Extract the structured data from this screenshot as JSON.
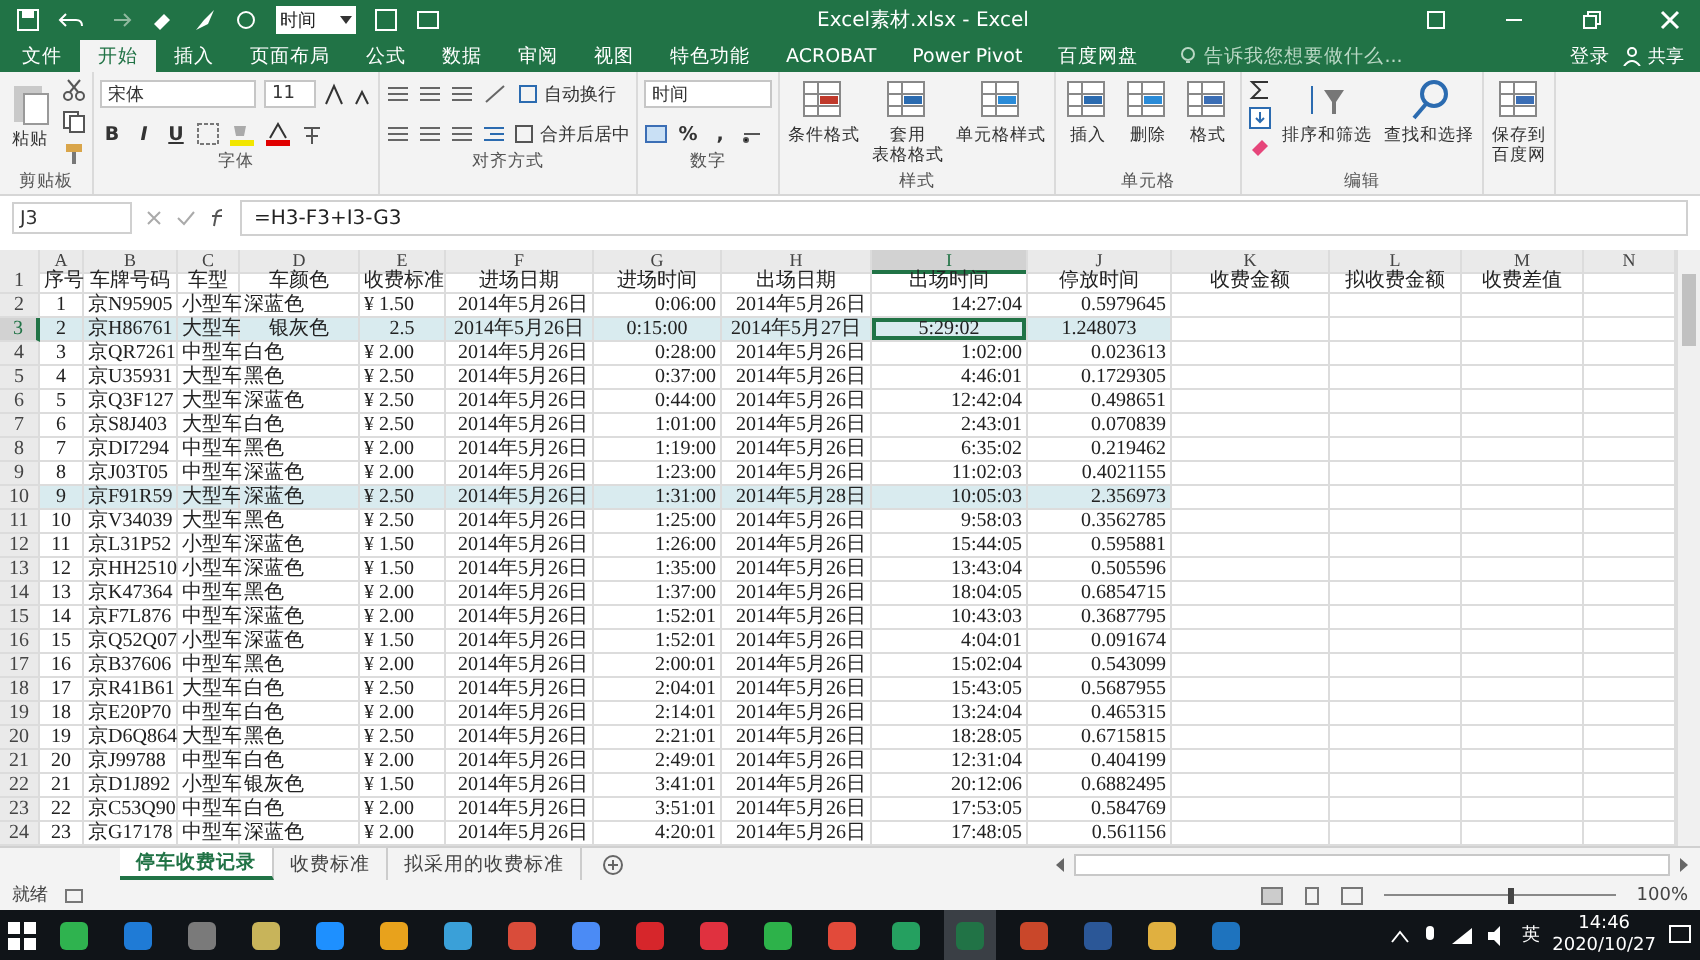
{
  "quick_access": {
    "combo": "时间"
  },
  "window": {
    "title": "Excel素材.xlsx - Excel"
  },
  "ribbon_tabs": [
    {
      "label": "文件",
      "selected": false
    },
    {
      "label": "开始",
      "selected": true
    },
    {
      "label": "插入",
      "selected": false
    },
    {
      "label": "页面布局",
      "selected": false
    },
    {
      "label": "公式",
      "selected": false
    },
    {
      "label": "数据",
      "selected": false
    },
    {
      "label": "审阅",
      "selected": false
    },
    {
      "label": "视图",
      "selected": false
    },
    {
      "label": "特色功能",
      "selected": false
    },
    {
      "label": "ACROBAT",
      "selected": false
    },
    {
      "label": "Power Pivot",
      "selected": false
    },
    {
      "label": "百度网盘",
      "selected": false
    }
  ],
  "search": {
    "placeholder": "告诉我您想要做什么..."
  },
  "account": {
    "sign_in": "登录",
    "share": "共享"
  },
  "ribbon_groups": [
    {
      "kind": "clipboard",
      "label": "剪贴板",
      "buttons": [
        "粘贴"
      ]
    },
    {
      "kind": "font",
      "label": "字体",
      "font": "宋体",
      "size": "11",
      "buttons": [
        "B",
        "I",
        "U"
      ]
    },
    {
      "kind": "alignment",
      "label": "对齐方式",
      "buttons": [
        "自动换行",
        "合并后居中"
      ]
    },
    {
      "kind": "number",
      "label": "数字",
      "format": "时间",
      "buttons": [
        "%",
        ","
      ]
    },
    {
      "kind": "large",
      "label": "样式",
      "buttons": [
        "条件格式",
        [
          "套用",
          "表格格式"
        ],
        "单元格样式"
      ]
    },
    {
      "kind": "large",
      "label": "单元格",
      "buttons": [
        "插入",
        "删除",
        "格式"
      ]
    },
    {
      "kind": "editing",
      "label": "编辑",
      "buttons": [
        "排序和筛选",
        "查找和选择"
      ]
    },
    {
      "kind": "large",
      "buttons": [
        [
          "保存到",
          "百度网"
        ]
      ]
    }
  ],
  "formula_bar": {
    "name_box": "J3",
    "formula": "=H3-F3+I3-G3"
  },
  "sheet": {
    "header_row": {
      "number": "1",
      "selected": false
    },
    "columns": [
      {
        "letter": "A",
        "header": "序号",
        "selected": false
      },
      {
        "letter": "B",
        "header": "车牌号码",
        "selected": false
      },
      {
        "letter": "C",
        "header": "车型",
        "selected": false
      },
      {
        "letter": "D",
        "header": "车颜色",
        "selected": false
      },
      {
        "letter": "E",
        "header": "收费标准",
        "selected": false
      },
      {
        "letter": "F",
        "header": "进场日期",
        "selected": false
      },
      {
        "letter": "G",
        "header": "进场时间",
        "selected": false
      },
      {
        "letter": "H",
        "header": "出场日期",
        "selected": false
      },
      {
        "letter": "I",
        "header": "出场时间",
        "selected": true
      },
      {
        "letter": "J",
        "header": "停放时间",
        "selected": false
      },
      {
        "letter": "K",
        "header": "收费金额",
        "selected": false
      },
      {
        "letter": "L",
        "header": "拟收费金额",
        "selected": false
      },
      {
        "letter": "M",
        "header": "收费差值",
        "selected": false
      },
      {
        "letter": "N",
        "selected": false
      }
    ],
    "rows": [
      {
        "number": "2",
        "selected": false,
        "highlighted": false,
        "kind": "standard",
        "cells": [
          "1",
          "京N95905",
          "小型车",
          "深蓝色",
          "¥ 1.50",
          "2014年5月26日",
          "0:06:00",
          "2014年5月26日",
          "14:27:04",
          "0.5979645"
        ]
      },
      {
        "number": "3",
        "selected": true,
        "highlighted": true,
        "kind": "centered",
        "cells": [
          "2",
          "京H86761",
          "大型车",
          "银灰色",
          "2.5",
          "2014年5月26日",
          "0:15:00",
          "2014年5月27日",
          "5:29:02",
          "1.248073"
        ]
      },
      {
        "number": "4",
        "selected": false,
        "highlighted": false,
        "kind": "standard",
        "cells": [
          "3",
          "京QR7261",
          "中型车",
          "白色",
          "¥ 2.00",
          "2014年5月26日",
          "0:28:00",
          "2014年5月26日",
          "1:02:00",
          "0.023613"
        ]
      },
      {
        "number": "5",
        "selected": false,
        "highlighted": false,
        "kind": "standard",
        "cells": [
          "4",
          "京U35931",
          "大型车",
          "黑色",
          "¥ 2.50",
          "2014年5月26日",
          "0:37:00",
          "2014年5月26日",
          "4:46:01",
          "0.1729305"
        ]
      },
      {
        "number": "6",
        "selected": false,
        "highlighted": false,
        "kind": "standard",
        "cells": [
          "5",
          "京Q3F127",
          "大型车",
          "深蓝色",
          "¥ 2.50",
          "2014年5月26日",
          "0:44:00",
          "2014年5月26日",
          "12:42:04",
          "0.498651"
        ]
      },
      {
        "number": "7",
        "selected": false,
        "highlighted": false,
        "kind": "standard",
        "cells": [
          "6",
          "京S8J403",
          "大型车",
          "白色",
          "¥ 2.50",
          "2014年5月26日",
          "1:01:00",
          "2014年5月26日",
          "2:43:01",
          "0.070839"
        ]
      },
      {
        "number": "8",
        "selected": false,
        "highlighted": false,
        "kind": "standard",
        "cells": [
          "7",
          "京DI7294",
          "中型车",
          "黑色",
          "¥ 2.00",
          "2014年5月26日",
          "1:19:00",
          "2014年5月26日",
          "6:35:02",
          "0.219462"
        ]
      },
      {
        "number": "9",
        "selected": false,
        "highlighted": false,
        "kind": "standard",
        "cells": [
          "8",
          "京J03T05",
          "中型车",
          "深蓝色",
          "¥ 2.00",
          "2014年5月26日",
          "1:23:00",
          "2014年5月26日",
          "11:02:03",
          "0.4021155"
        ]
      },
      {
        "number": "10",
        "selected": false,
        "highlighted": true,
        "kind": "standard",
        "cells": [
          "9",
          "京F91R59",
          "大型车",
          "深蓝色",
          "¥ 2.50",
          "2014年5月26日",
          "1:31:00",
          "2014年5月28日",
          "10:05:03",
          "2.356973"
        ]
      },
      {
        "number": "11",
        "selected": false,
        "highlighted": false,
        "kind": "standard",
        "cells": [
          "10",
          "京V34039",
          "大型车",
          "黑色",
          "¥ 2.50",
          "2014年5月26日",
          "1:25:00",
          "2014年5月26日",
          "9:58:03",
          "0.3562785"
        ]
      },
      {
        "number": "12",
        "selected": false,
        "highlighted": false,
        "kind": "standard",
        "cells": [
          "11",
          "京L31P52",
          "小型车",
          "深蓝色",
          "¥ 1.50",
          "2014年5月26日",
          "1:26:00",
          "2014年5月26日",
          "15:44:05",
          "0.595881"
        ]
      },
      {
        "number": "13",
        "selected": false,
        "highlighted": false,
        "kind": "standard",
        "cells": [
          "12",
          "京HH2510",
          "小型车",
          "深蓝色",
          "¥ 1.50",
          "2014年5月26日",
          "1:35:00",
          "2014年5月26日",
          "13:43:04",
          "0.505596"
        ]
      },
      {
        "number": "14",
        "selected": false,
        "highlighted": false,
        "kind": "standard",
        "cells": [
          "13",
          "京K47364",
          "中型车",
          "黑色",
          "¥ 2.00",
          "2014年5月26日",
          "1:37:00",
          "2014年5月26日",
          "18:04:05",
          "0.6854715"
        ]
      },
      {
        "number": "15",
        "selected": false,
        "highlighted": false,
        "kind": "standard",
        "cells": [
          "14",
          "京F7L876",
          "中型车",
          "深蓝色",
          "¥ 2.00",
          "2014年5月26日",
          "1:52:01",
          "2014年5月26日",
          "10:43:03",
          "0.3687795"
        ]
      },
      {
        "number": "16",
        "selected": false,
        "highlighted": false,
        "kind": "standard",
        "cells": [
          "15",
          "京Q52Q07",
          "小型车",
          "深蓝色",
          "¥ 1.50",
          "2014年5月26日",
          "1:52:01",
          "2014年5月26日",
          "4:04:01",
          "0.091674"
        ]
      },
      {
        "number": "17",
        "selected": false,
        "highlighted": false,
        "kind": "standard",
        "cells": [
          "16",
          "京B37606",
          "中型车",
          "黑色",
          "¥ 2.00",
          "2014年5月26日",
          "2:00:01",
          "2014年5月26日",
          "15:02:04",
          "0.543099"
        ]
      },
      {
        "number": "18",
        "selected": false,
        "highlighted": false,
        "kind": "standard",
        "cells": [
          "17",
          "京R41B61",
          "大型车",
          "白色",
          "¥ 2.50",
          "2014年5月26日",
          "2:04:01",
          "2014年5月26日",
          "15:43:05",
          "0.5687955"
        ]
      },
      {
        "number": "19",
        "selected": false,
        "highlighted": false,
        "kind": "standard",
        "cells": [
          "18",
          "京E20P70",
          "中型车",
          "白色",
          "¥ 2.00",
          "2014年5月26日",
          "2:14:01",
          "2014年5月26日",
          "13:24:04",
          "0.465315"
        ]
      },
      {
        "number": "20",
        "selected": false,
        "highlighted": false,
        "kind": "standard",
        "cells": [
          "19",
          "京D6Q864",
          "大型车",
          "黑色",
          "¥ 2.50",
          "2014年5月26日",
          "2:21:01",
          "2014年5月26日",
          "18:28:05",
          "0.6715815"
        ]
      },
      {
        "number": "21",
        "selected": false,
        "highlighted": false,
        "kind": "standard",
        "cells": [
          "20",
          "京J99788",
          "中型车",
          "白色",
          "¥ 2.00",
          "2014年5月26日",
          "2:49:01",
          "2014年5月26日",
          "12:31:04",
          "0.404199"
        ]
      },
      {
        "number": "22",
        "selected": false,
        "highlighted": false,
        "kind": "standard",
        "cells": [
          "21",
          "京D1J892",
          "小型车",
          "银灰色",
          "¥ 1.50",
          "2014年5月26日",
          "3:41:01",
          "2014年5月26日",
          "20:12:06",
          "0.6882495"
        ]
      },
      {
        "number": "23",
        "selected": false,
        "highlighted": false,
        "kind": "standard",
        "cells": [
          "22",
          "京C53Q90",
          "中型车",
          "白色",
          "¥ 2.00",
          "2014年5月26日",
          "3:51:01",
          "2014年5月26日",
          "17:53:05",
          "0.584769"
        ]
      },
      {
        "number": "24",
        "selected": false,
        "highlighted": false,
        "kind": "standard",
        "cells": [
          "23",
          "京G17178",
          "中型车",
          "深蓝色",
          "¥ 2.00",
          "2014年5月26日",
          "4:20:01",
          "2014年5月26日",
          "17:48:05",
          "0.561156"
        ]
      }
    ]
  },
  "sheet_tabs": [
    {
      "label": "停车收费记录",
      "selected": true
    },
    {
      "label": "收费标准",
      "selected": false
    },
    {
      "label": "拟采用的收费标准",
      "selected": false
    }
  ],
  "status_bar": {
    "text": "就绪",
    "zoom": "100%",
    "level": 0.55
  },
  "taskbar": {
    "ime": "英",
    "time": "14:46",
    "date": "2020/10/27"
  }
}
